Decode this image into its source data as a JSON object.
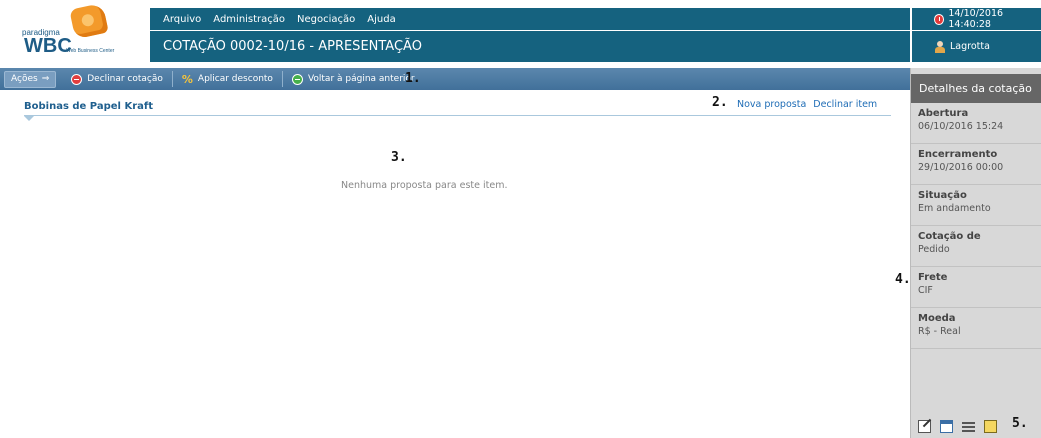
{
  "branding": {
    "small_text": "paradigma",
    "logo_text": "WBC",
    "tagline": "Web Business Center"
  },
  "menu": [
    "Arquivo",
    "Administração",
    "Negociação",
    "Ajuda"
  ],
  "page_title": "COTAÇÃO 0002-10/16 - APRESENTAÇÃO",
  "datetime": "14/10/2016 14:40:28",
  "user": "Lagrotta",
  "toolbar": {
    "actions_label": "Ações",
    "actions_arrow": "⇒",
    "decline_quote": "Declinar cotação",
    "apply_discount": "Aplicar desconto",
    "go_back": "Voltar à página anterior"
  },
  "item": {
    "title": "Bobinas de Papel Kraft",
    "new_proposal": "Nova proposta",
    "decline_item": "Declinar item",
    "empty_message": "Nenhuma proposta para este item."
  },
  "details": {
    "title": "Detalhes da cotação",
    "fields": [
      {
        "label": "Abertura",
        "value": "06/10/2016 15:24"
      },
      {
        "label": "Encerramento",
        "value": "29/10/2016 00:00"
      },
      {
        "label": "Situação",
        "value": "Em andamento"
      },
      {
        "label": "Cotação de",
        "value": "Pedido"
      },
      {
        "label": "Frete",
        "value": "CIF"
      },
      {
        "label": "Moeda",
        "value": "R$ - Real"
      }
    ]
  },
  "footer_icons": [
    "edit-icon",
    "calendar-icon",
    "list-icon",
    "documents-icon"
  ],
  "callouts": [
    "1.",
    "2.",
    "3.",
    "4.",
    "5."
  ],
  "colors": {
    "header_bg": "#15627f",
    "toolbar_bg": "#4a7aa3",
    "panel_bg": "#d8d8d8",
    "panel_header": "#666666",
    "link": "#1e6cb5"
  }
}
